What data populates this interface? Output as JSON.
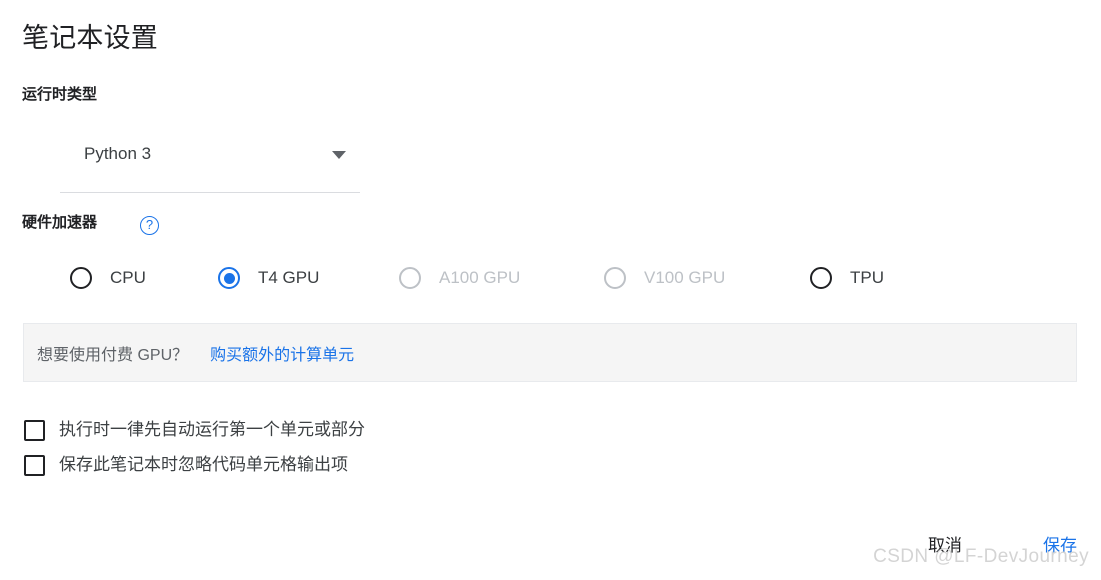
{
  "dialog": {
    "title": "笔记本设置"
  },
  "runtime": {
    "label": "运行时类型",
    "selected": "Python 3",
    "options": [
      "Python 3"
    ]
  },
  "accelerator": {
    "label": "硬件加速器",
    "help_icon": "help-circle-icon",
    "help_glyph": "?",
    "options": [
      {
        "label": "CPU",
        "selected": false,
        "disabled": false
      },
      {
        "label": "T4 GPU",
        "selected": true,
        "disabled": false
      },
      {
        "label": "A100 GPU",
        "selected": false,
        "disabled": true
      },
      {
        "label": "V100 GPU",
        "selected": false,
        "disabled": true
      },
      {
        "label": "TPU",
        "selected": false,
        "disabled": false
      }
    ]
  },
  "banner": {
    "text": "想要使用付费 GPU？",
    "link": "购买额外的计算单元"
  },
  "checkboxes": [
    {
      "label": "执行时一律先自动运行第一个单元或部分",
      "checked": false
    },
    {
      "label": "保存此笔记本时忽略代码单元格输出项",
      "checked": false
    }
  ],
  "footer": {
    "cancel_label": "取消",
    "save_label": "保存"
  },
  "watermark": {
    "text": "CSDN @LF-DevJourney"
  },
  "colors": {
    "accent": "#1a73e8",
    "text_primary": "#202124",
    "text_secondary": "#3c4043",
    "text_muted": "#5f6368",
    "disabled": "#bdc1c6",
    "banner_bg": "#f5f5f5",
    "divider": "#dadce0",
    "watermark": "#d4d4d4"
  }
}
